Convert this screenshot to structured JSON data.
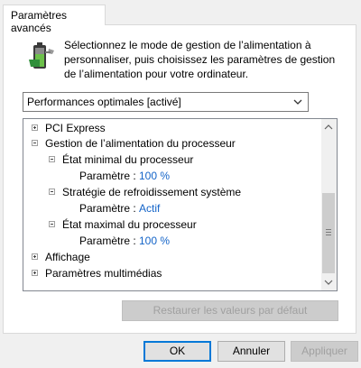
{
  "tab": {
    "label": "Paramètres avancés"
  },
  "description": "Sélectionnez le mode de gestion de l’alimentation à personnaliser, puis choisissez les paramètres de gestion de l’alimentation pour votre ordinateur.",
  "plan_select": {
    "value": "Performances optimales [activé]"
  },
  "tree": {
    "items": [
      {
        "label": "PCI Express"
      },
      {
        "label": "Gestion de l’alimentation du processeur"
      },
      {
        "label": "État minimal du processeur"
      },
      {
        "label": "Paramètre :",
        "value": "100  %"
      },
      {
        "label": "Stratégie de refroidissement système"
      },
      {
        "label": "Paramètre :",
        "value": "Actif"
      },
      {
        "label": "État maximal du processeur"
      },
      {
        "label": "Paramètre :",
        "value": "100  %"
      },
      {
        "label": "Affichage"
      },
      {
        "label": "Paramètres multimédias"
      }
    ]
  },
  "buttons": {
    "restore": "Restaurer les valeurs par défaut",
    "ok": "OK",
    "cancel": "Annuler",
    "apply": "Appliquer"
  },
  "colors": {
    "value_text": "#1464c8",
    "focus_border": "#0078d7"
  }
}
